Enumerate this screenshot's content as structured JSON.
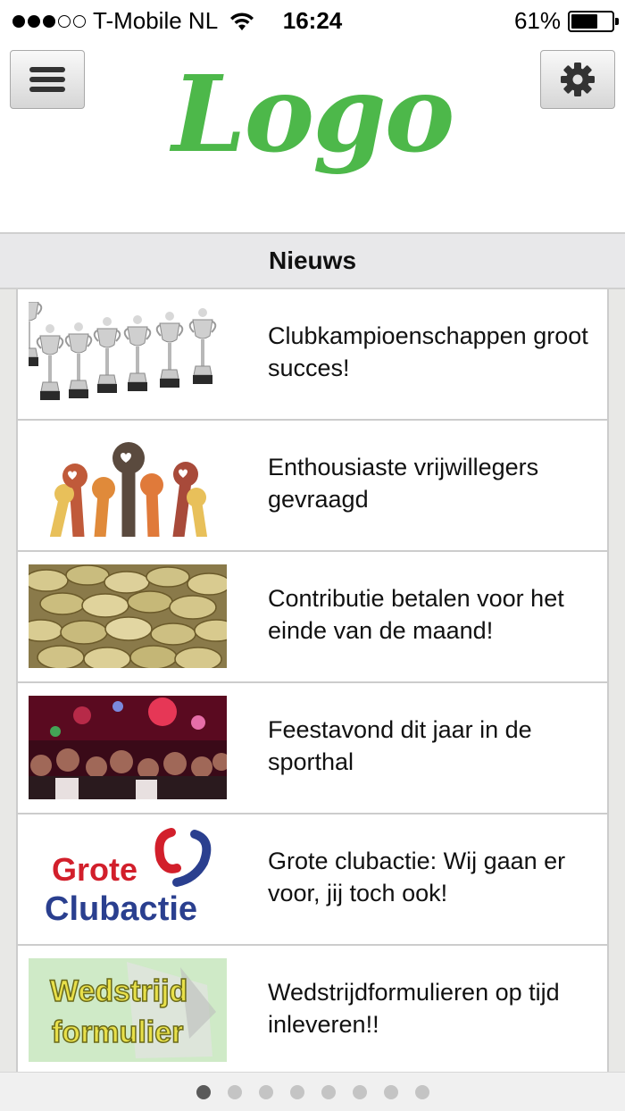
{
  "status_bar": {
    "carrier": "T-Mobile NL",
    "time": "16:24",
    "battery": "61%",
    "battery_level": 0.61,
    "signal_bars": 3,
    "signal_total": 5
  },
  "header": {
    "logo_text": "Logo",
    "logo_color": "#4db84a",
    "menu_icon": "hamburger-menu-icon",
    "settings_icon": "gear-icon"
  },
  "section": {
    "title": "Nieuws"
  },
  "news": [
    {
      "title": "Clubkampioenschappen groot succes!",
      "image": "trophies-image"
    },
    {
      "title": "Enthousiaste vrijwillegers gevraagd",
      "image": "raised-hands-image"
    },
    {
      "title": "Contributie betalen voor het einde van de maand!",
      "image": "coins-image"
    },
    {
      "title": "Feestavond dit jaar in de sporthal",
      "image": "party-crowd-image"
    },
    {
      "title": "Grote clubactie: Wij gaan er voor, jij toch ook!",
      "image": "grote-clubactie-logo",
      "image_text": {
        "line1": "Grote",
        "line2": "Clubactie"
      }
    },
    {
      "title": "Wedstrijdformulieren op tijd inleveren!!",
      "image": "wedstrijd-formulier-image",
      "image_text": {
        "line1": "Wedstrijd",
        "line2": "formulier"
      }
    }
  ],
  "pager": {
    "total": 8,
    "active": 0
  }
}
